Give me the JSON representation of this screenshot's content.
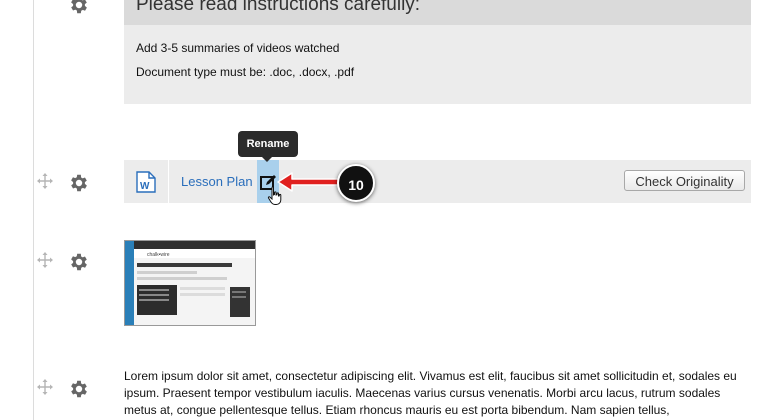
{
  "instructions": {
    "title": "Please read instructions carefully:",
    "line1": "Add 3-5 summaries of videos watched",
    "line2": "Document type must be: .doc, .docx, .pdf"
  },
  "file_row": {
    "file_icon": "word-document-icon",
    "file_name": "Lesson Plan",
    "rename_icon": "edit-icon",
    "check_button": "Check Originality"
  },
  "tooltip": {
    "text": "Rename"
  },
  "callout": {
    "number": "10",
    "arrow_color": "#e0201f"
  },
  "thumbnail": {
    "logo_text": "chalk•wire"
  },
  "paragraph": {
    "text": "Lorem ipsum dolor sit amet, consectetur adipiscing elit. Vivamus est elit, faucibus sit amet sollicitudin et, sodales eu ipsum. Praesent tempor vestibulum iaculis. Maecenas varius cursus venenatis. Morbi arcu lacus, rutrum sodales metus at, congue pellentesque tellus. Etiam rhoncus mauris eu est porta bibendum. Nam sapien tellus,"
  },
  "colors": {
    "link": "#2a6ebb",
    "rename_highlight": "#a9d0ec",
    "panel": "#ececec"
  }
}
